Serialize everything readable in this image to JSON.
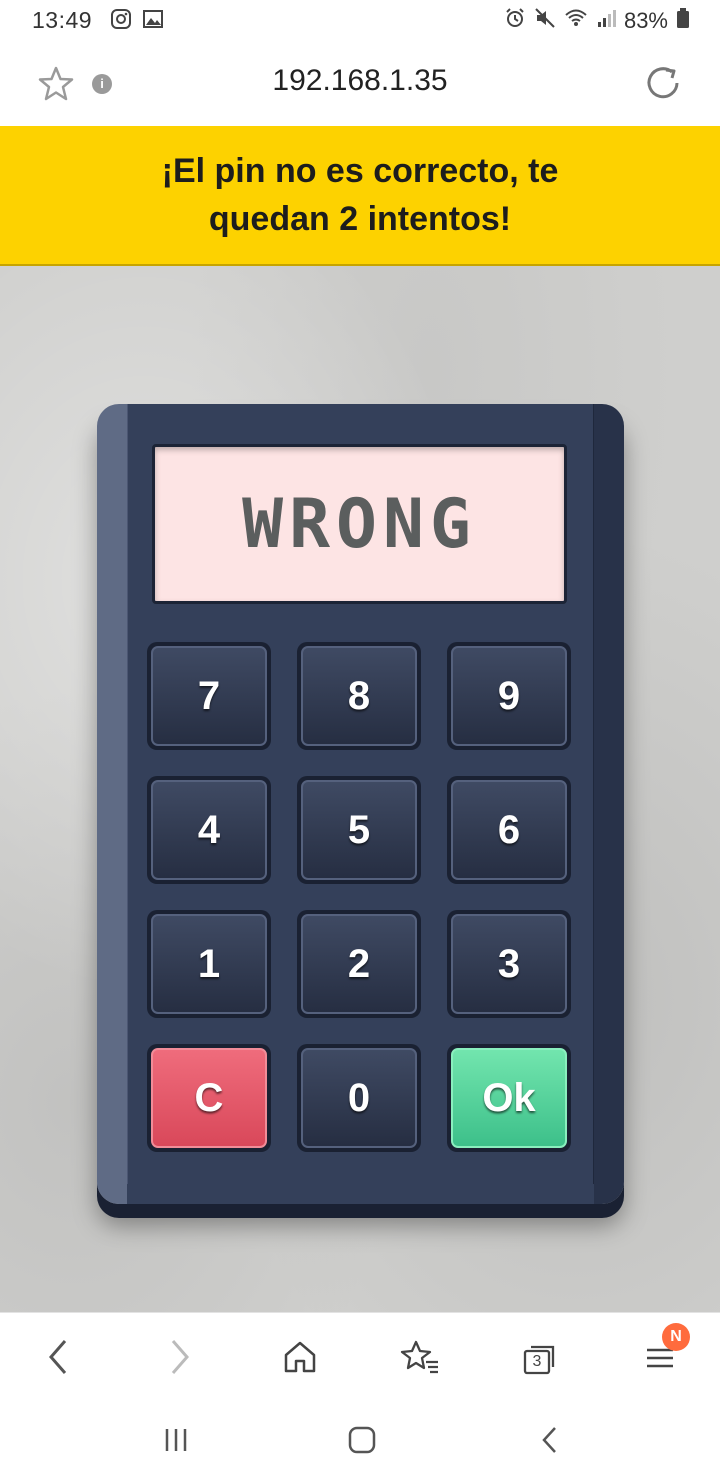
{
  "status": {
    "time": "13:49",
    "battery": "83%"
  },
  "browser": {
    "url": "192.168.1.35",
    "tabs_count": "3",
    "menu_badge": "N"
  },
  "banner": {
    "message": "¡El pin no es correcto, te quedan 2 intentos!"
  },
  "keypad": {
    "display": "WRONG",
    "keys": [
      "7",
      "8",
      "9",
      "4",
      "5",
      "6",
      "1",
      "2",
      "3",
      "C",
      "0",
      "Ok"
    ]
  },
  "colors": {
    "banner": "#fdd200",
    "clear_key": "#e25a6a",
    "ok_key": "#55d49c",
    "display_bg": "#fde4e4"
  }
}
